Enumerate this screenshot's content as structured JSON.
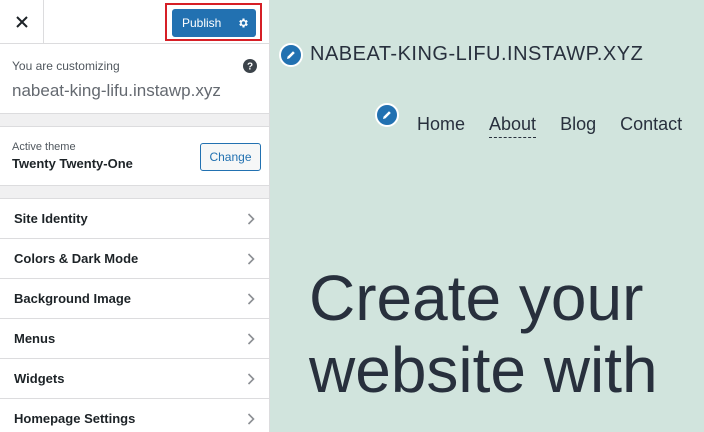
{
  "topbar": {
    "close_icon": "close-icon",
    "publish_label": "Publish",
    "settings_icon": "gear-icon"
  },
  "customizing": {
    "label": "You are customizing",
    "site": "nabeat-king-lifu.instawp.xyz",
    "help_icon": "question-circle-icon"
  },
  "theme": {
    "label": "Active theme",
    "name": "Twenty Twenty-One",
    "change_label": "Change"
  },
  "sections": [
    {
      "label": "Site Identity"
    },
    {
      "label": "Colors & Dark Mode"
    },
    {
      "label": "Background Image"
    },
    {
      "label": "Menus"
    },
    {
      "label": "Widgets"
    },
    {
      "label": "Homepage Settings"
    }
  ],
  "preview": {
    "site_title": "NABEAT-KING-LIFU.INSTAWP.XYZ",
    "nav": [
      {
        "label": "Home"
      },
      {
        "label": "About"
      },
      {
        "label": "Blog"
      },
      {
        "label": "Contact"
      }
    ],
    "hero_line1": "Create your",
    "hero_line2": "website with"
  },
  "colors": {
    "accent": "#2271b1",
    "highlight": "#d61f26",
    "preview_bg": "#d1e4dd"
  }
}
